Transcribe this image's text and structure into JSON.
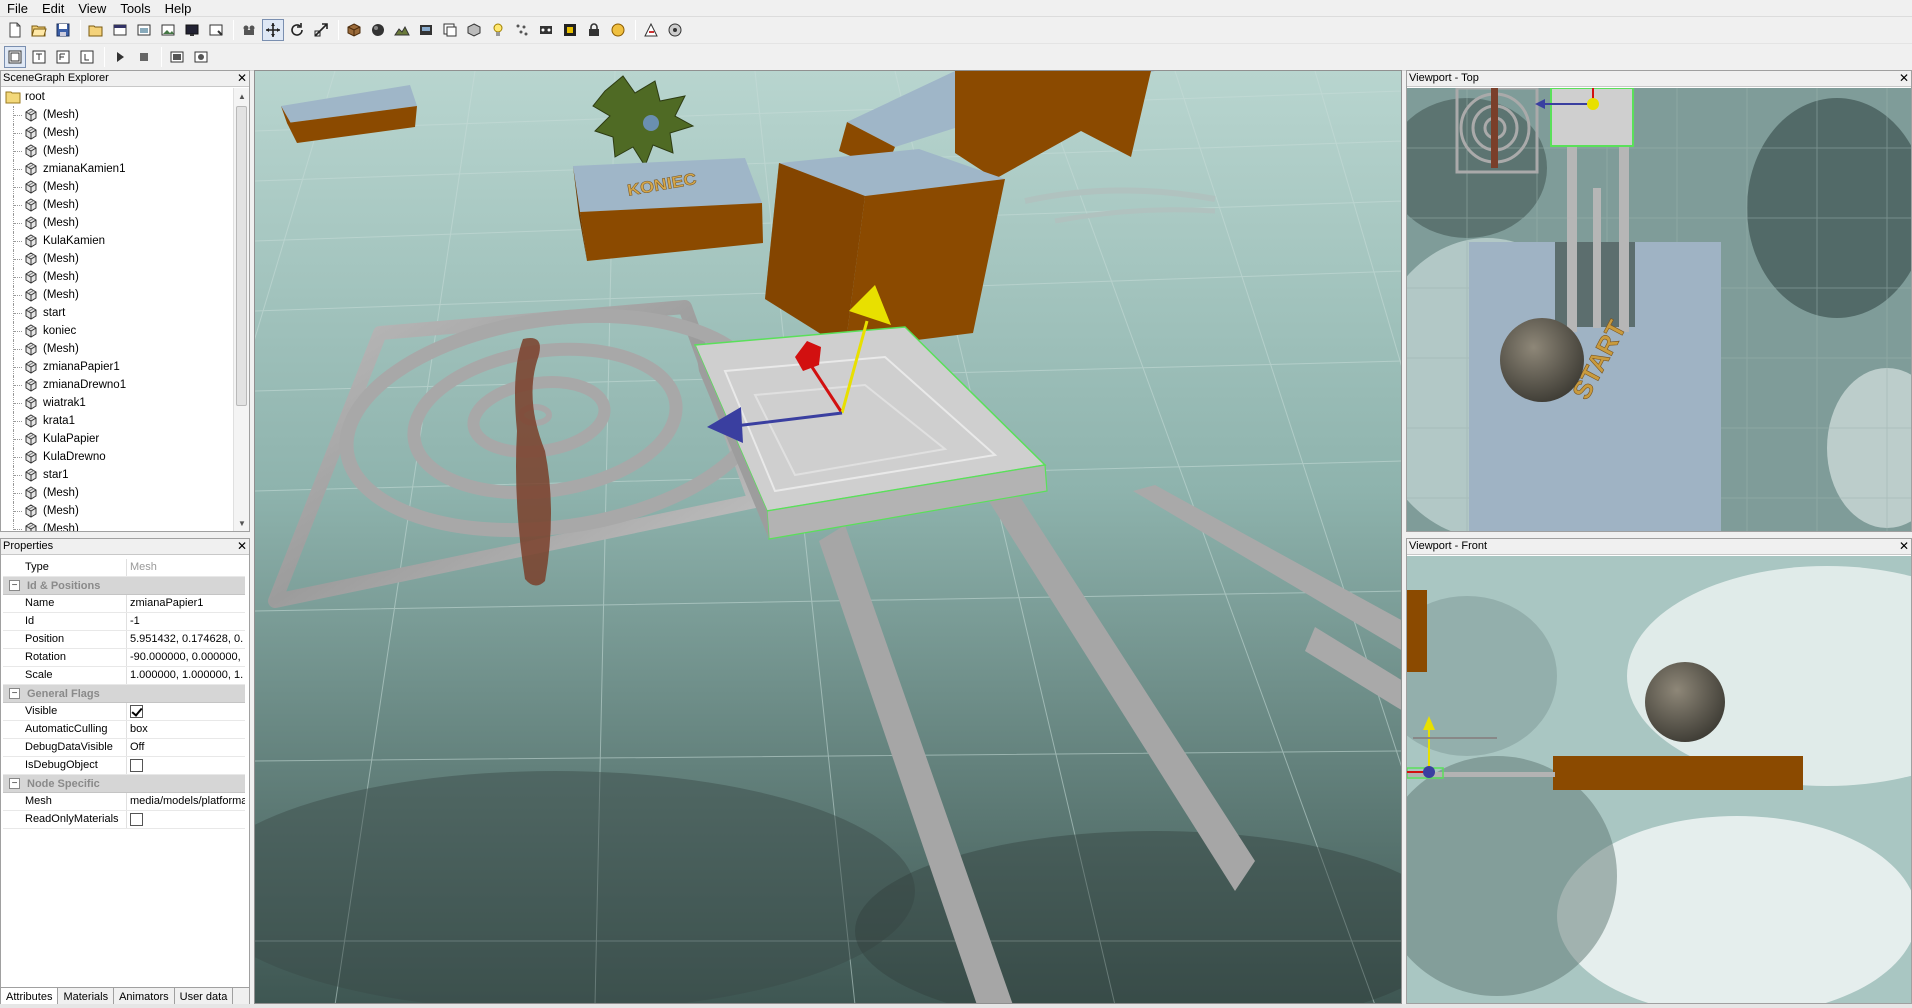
{
  "menubar": {
    "items": [
      "File",
      "Edit",
      "View",
      "Tools",
      "Help"
    ]
  },
  "toolbar1": {
    "icons": [
      "new-file-icon",
      "open-file-icon",
      "save-icon",
      "import-icon",
      "export-icon",
      "window-icon",
      "image-icon",
      "screen-icon",
      "render-icon",
      "camera-icon",
      "move-gizmo-icon",
      "rotate-gizmo-icon",
      "scale-gizmo-icon",
      "cube-icon",
      "sphere-icon",
      "terrain-icon",
      "skybox-icon",
      "billboard-icon",
      "octree-icon",
      "light-icon",
      "particle-icon",
      "animated-mesh-icon",
      "water-icon",
      "lock-icon",
      "triangle-icon",
      "paint-icon"
    ]
  },
  "toolbar2": {
    "icons": [
      "view-persp-icon",
      "view-top-icon",
      "view-front-icon",
      "view-left-icon",
      "play-icon",
      "stop-icon",
      "snapshot-icon",
      "screenshot-icon"
    ]
  },
  "scenegraph": {
    "title": "SceneGraph Explorer",
    "root_label": "root",
    "items": [
      "(Mesh)",
      "(Mesh)",
      "(Mesh)",
      "zmianaKamien1",
      "(Mesh)",
      "(Mesh)",
      "(Mesh)",
      "KulaKamien",
      "(Mesh)",
      "(Mesh)",
      "(Mesh)",
      "start",
      "koniec",
      "(Mesh)",
      "zmianaPapier1",
      "zmianaDrewno1",
      "wiatrak1",
      "krata1",
      "KulaPapier",
      "KulaDrewno",
      "star1",
      "(Mesh)",
      "(Mesh)",
      "(Mesh)"
    ]
  },
  "properties": {
    "title": "Properties",
    "type_label": "Type",
    "type_value": "Mesh",
    "groups": {
      "id_positions": "Id & Positions",
      "general_flags": "General Flags",
      "node_specific": "Node Specific"
    },
    "rows": {
      "name": {
        "key": "Name",
        "value": "zmianaPapier1"
      },
      "id": {
        "key": "Id",
        "value": "-1"
      },
      "position": {
        "key": "Position",
        "value": "5.951432, 0.174628, 0."
      },
      "rotation": {
        "key": "Rotation",
        "value": "-90.000000, 0.000000,"
      },
      "scale": {
        "key": "Scale",
        "value": "1.000000, 1.000000, 1."
      },
      "visible": {
        "key": "Visible",
        "checked": true
      },
      "culling": {
        "key": "AutomaticCulling",
        "value": "box"
      },
      "debugdata": {
        "key": "DebugDataVisible",
        "value": "Off"
      },
      "isdebug": {
        "key": "IsDebugObject",
        "checked": false
      },
      "mesh": {
        "key": "Mesh",
        "value": "media/models/platforma"
      },
      "readonly": {
        "key": "ReadOnlyMaterials",
        "checked": false
      }
    },
    "tabs": [
      "Attributes",
      "Materials",
      "Animators",
      "User data"
    ],
    "selected_tab": "Attributes"
  },
  "viewport_top": {
    "title": "Viewport - Top"
  },
  "viewport_front": {
    "title": "Viewport - Front"
  },
  "scene": {
    "texture_text_start": "START",
    "texture_text_koniec": "KONIEC"
  },
  "colors": {
    "sky": "#8fb4ad",
    "platform_orange": "#8b4a00",
    "platform_top": "#9db3c7",
    "gizmo_x": "#d21010",
    "gizmo_y": "#e8e000",
    "gizmo_z": "#3a3fa0",
    "selection": "#5ae05a"
  }
}
